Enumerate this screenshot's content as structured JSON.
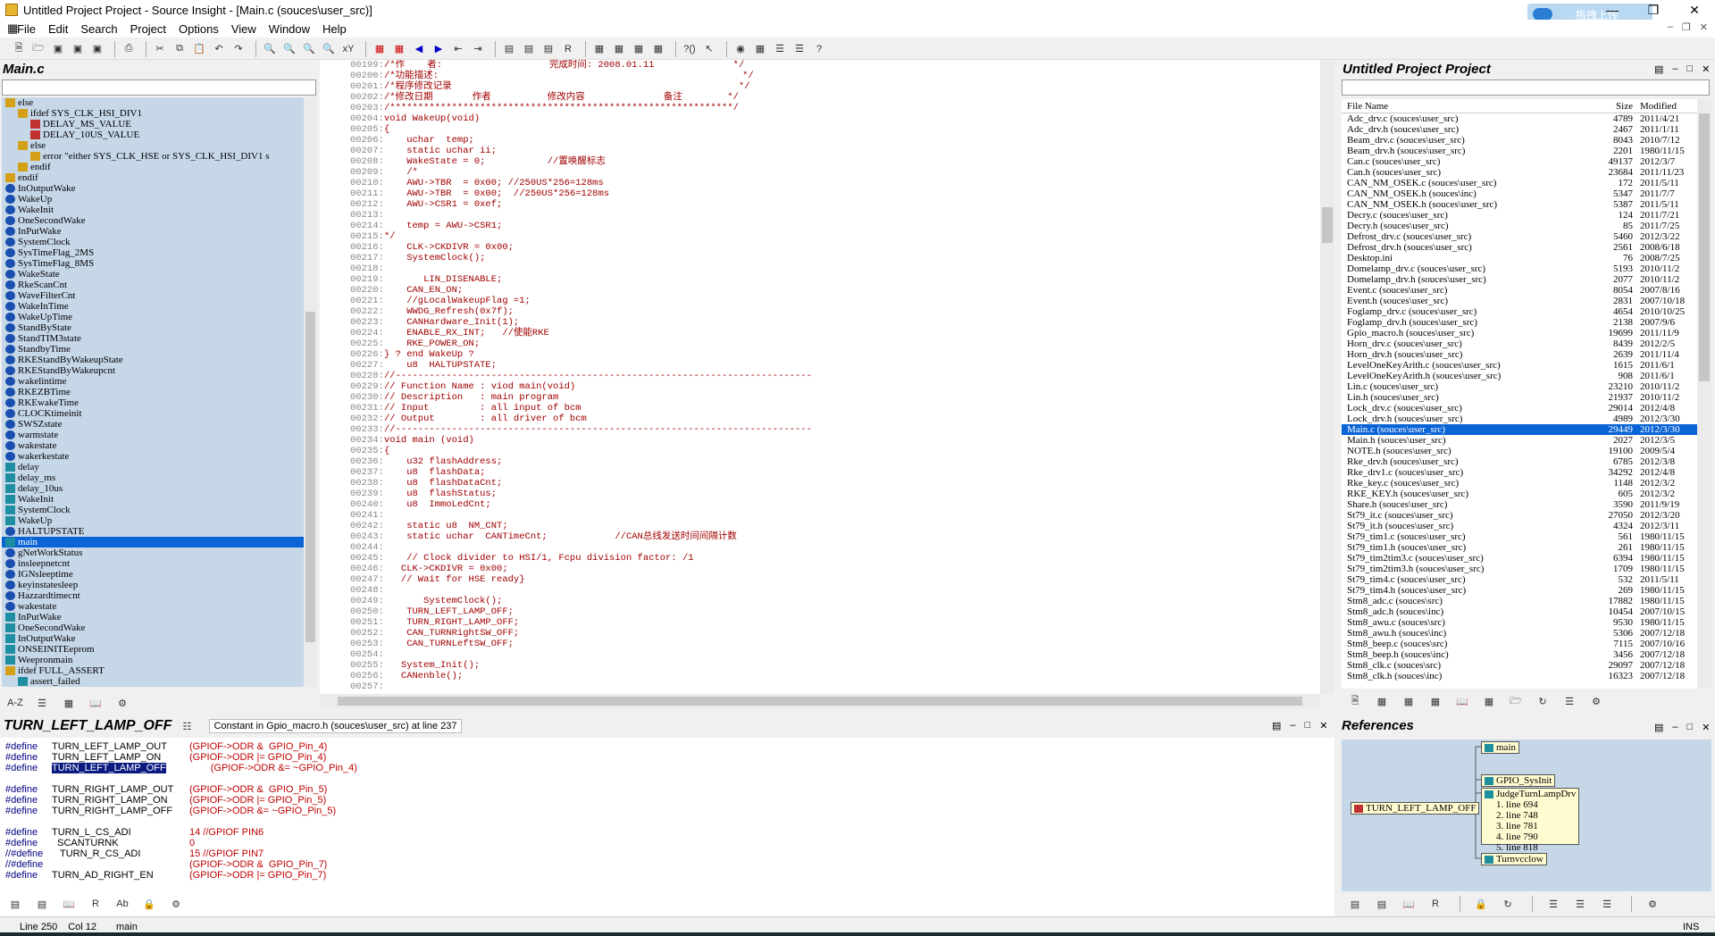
{
  "window": {
    "title": "Untitled Project Project - Source Insight - [Main.c (souces\\user_src)]",
    "upload_label": "拖拽上传"
  },
  "menu": [
    "File",
    "Edit",
    "Search",
    "Project",
    "Options",
    "View",
    "Window",
    "Help"
  ],
  "left": {
    "title": "Main.c",
    "symbols": [
      {
        "t": "else",
        "i": "cond",
        "d": 0
      },
      {
        "t": "ifdef SYS_CLK_HSI_DIV1",
        "i": "cond",
        "d": 1
      },
      {
        "t": "DELAY_MS_VALUE",
        "i": "def",
        "d": 2
      },
      {
        "t": "DELAY_10US_VALUE",
        "i": "def",
        "d": 2
      },
      {
        "t": "else",
        "i": "cond",
        "d": 1
      },
      {
        "t": "error \"either SYS_CLK_HSE or SYS_CLK_HSI_DIV1 s",
        "i": "cond",
        "d": 2
      },
      {
        "t": "endif",
        "i": "cond",
        "d": 1
      },
      {
        "t": "endif",
        "i": "cond",
        "d": 0
      },
      {
        "t": "InOutputWake",
        "i": "var",
        "d": 0
      },
      {
        "t": "WakeUp",
        "i": "var",
        "d": 0
      },
      {
        "t": "WakeInit",
        "i": "var",
        "d": 0
      },
      {
        "t": "OneSecondWake",
        "i": "var",
        "d": 0
      },
      {
        "t": "InPutWake",
        "i": "var",
        "d": 0
      },
      {
        "t": "SystemClock",
        "i": "var",
        "d": 0
      },
      {
        "t": "SysTimeFlag_2MS",
        "i": "var",
        "d": 0
      },
      {
        "t": "SysTimeFlag_8MS",
        "i": "var",
        "d": 0
      },
      {
        "t": "WakeState",
        "i": "var",
        "d": 0
      },
      {
        "t": "RkeScanCnt",
        "i": "var",
        "d": 0
      },
      {
        "t": "WaveFilterCnt",
        "i": "var",
        "d": 0
      },
      {
        "t": "WakeInTime",
        "i": "var",
        "d": 0
      },
      {
        "t": "WakeUpTime",
        "i": "var",
        "d": 0
      },
      {
        "t": "StandByState",
        "i": "var",
        "d": 0
      },
      {
        "t": "StandTIM3state",
        "i": "var",
        "d": 0
      },
      {
        "t": "StandbyTime",
        "i": "var",
        "d": 0
      },
      {
        "t": "RKEStandByWakeupState",
        "i": "var",
        "d": 0
      },
      {
        "t": "RKEStandByWakeupcnt",
        "i": "var",
        "d": 0
      },
      {
        "t": "wakelintime",
        "i": "var",
        "d": 0
      },
      {
        "t": "RKEZBTime",
        "i": "var",
        "d": 0
      },
      {
        "t": "RKEwakeTime",
        "i": "var",
        "d": 0
      },
      {
        "t": "CLOCKtimeinit",
        "i": "var",
        "d": 0
      },
      {
        "t": "SWSZstate",
        "i": "var",
        "d": 0
      },
      {
        "t": "warmstate",
        "i": "var",
        "d": 0
      },
      {
        "t": "wakestate",
        "i": "var",
        "d": 0
      },
      {
        "t": "wakerkestate",
        "i": "var",
        "d": 0
      },
      {
        "t": "delay",
        "i": "func",
        "d": 0
      },
      {
        "t": "delay_ms",
        "i": "func",
        "d": 0
      },
      {
        "t": "delay_10us",
        "i": "func",
        "d": 0
      },
      {
        "t": "WakeInit",
        "i": "func",
        "d": 0
      },
      {
        "t": "SystemClock",
        "i": "func",
        "d": 0
      },
      {
        "t": "WakeUp",
        "i": "func",
        "d": 0
      },
      {
        "t": "HALTUPSTATE",
        "i": "var",
        "d": 0
      },
      {
        "t": "main",
        "i": "func",
        "d": 0,
        "sel": true
      },
      {
        "t": "gNetWorkStatus",
        "i": "var",
        "d": 0
      },
      {
        "t": "insleepnetcnt",
        "i": "var",
        "d": 0
      },
      {
        "t": "IGNsleeptime",
        "i": "var",
        "d": 0
      },
      {
        "t": "keyinstatesleep",
        "i": "var",
        "d": 0
      },
      {
        "t": "Hazzardtimecnt",
        "i": "var",
        "d": 0
      },
      {
        "t": "wakestate",
        "i": "var",
        "d": 0
      },
      {
        "t": "InPutWake",
        "i": "func",
        "d": 0
      },
      {
        "t": "OneSecondWake",
        "i": "func",
        "d": 0
      },
      {
        "t": "InOutputWake",
        "i": "func",
        "d": 0
      },
      {
        "t": "ONSEINITEeprom",
        "i": "func",
        "d": 0
      },
      {
        "t": "Weepronmain",
        "i": "func",
        "d": 0
      },
      {
        "t": "ifdef FULL_ASSERT",
        "i": "cond",
        "d": 0
      },
      {
        "t": "assert_failed",
        "i": "func",
        "d": 1
      }
    ]
  },
  "code": [
    {
      "n": "00199:",
      "s": "/*作    者:                   完成时间: 2008.01.11              */",
      "c": "cm"
    },
    {
      "n": "00200:",
      "s": "/*功能描述:                                                      */",
      "c": "cm"
    },
    {
      "n": "00201:",
      "s": "/*程序修改记录                                                   */",
      "c": "cm"
    },
    {
      "n": "00202:",
      "s": "/*修改日期       作者          修改内容              备注        */",
      "c": "cm"
    },
    {
      "n": "00203:",
      "s": "/*************************************************************/",
      "c": "cm"
    },
    {
      "n": "00204:",
      "s": "void WakeUp(void)",
      "c": "kw"
    },
    {
      "n": "00205:",
      "s": "{",
      "c": "kw"
    },
    {
      "n": "00206:",
      "s": "    uchar  temp;",
      "c": "kw"
    },
    {
      "n": "00207:",
      "s": "    static uchar ii;",
      "c": "kw"
    },
    {
      "n": "00208:",
      "s": "    WakeState = 0;           //置唤醒标志",
      "c": "rd"
    },
    {
      "n": "00209:",
      "s": "    /*",
      "c": "cm"
    },
    {
      "n": "00210:",
      "s": "    AWU->TBR  = 0x00; //250US*256=128ms",
      "c": "cm"
    },
    {
      "n": "00211:",
      "s": "    AWU->TBR  = 0x00;  //250US*256=128ms",
      "c": "cm"
    },
    {
      "n": "00212:",
      "s": "    AWU->CSR1 = 0xef;",
      "c": "cm"
    },
    {
      "n": "00213:",
      "s": "",
      "c": "cm"
    },
    {
      "n": "00214:",
      "s": "    temp = AWU->CSR1;",
      "c": "cm"
    },
    {
      "n": "00215:",
      "s": "*/",
      "c": "cm"
    },
    {
      "n": "00216:",
      "s": "    CLK->CKDIVR = 0x00;",
      "c": "rd"
    },
    {
      "n": "00217:",
      "s": "    SystemClock();",
      "c": "rd"
    },
    {
      "n": "00218:",
      "s": "",
      "c": "kw"
    },
    {
      "n": "00219:",
      "s": "       LIN_DISENABLE;",
      "c": "rd"
    },
    {
      "n": "00220:",
      "s": "    CAN_EN_ON;",
      "c": "rd"
    },
    {
      "n": "00221:",
      "s": "    //gLocalWakeupFlag =1;",
      "c": "rd"
    },
    {
      "n": "00222:",
      "s": "    WWDG_Refresh(0x7f);",
      "c": "rd"
    },
    {
      "n": "00223:",
      "s": "    CANHardware_Init(1);",
      "c": "rd"
    },
    {
      "n": "00224:",
      "s": "    ENABLE_RX_INT;   //使能RKE",
      "c": "rd"
    },
    {
      "n": "00225:",
      "s": "    RKE_POWER_ON;",
      "c": "rd"
    },
    {
      "n": "00226:",
      "s": "} ? end WakeUp ?",
      "c": "kw"
    },
    {
      "n": "00227:",
      "s": "    u8  HALTUPSTATE;",
      "c": "kw"
    },
    {
      "n": "00228:",
      "s": "//--------------------------------------------------------------------------",
      "c": "cm"
    },
    {
      "n": "00229:",
      "s": "// Function Name : viod main(void)",
      "c": "cm"
    },
    {
      "n": "00230:",
      "s": "// Description   : main program",
      "c": "cm"
    },
    {
      "n": "00231:",
      "s": "// Input         : all input of bcm",
      "c": "cm"
    },
    {
      "n": "00232:",
      "s": "// Output        : all driver of bcm",
      "c": "cm"
    },
    {
      "n": "00233:",
      "s": "//--------------------------------------------------------------------------",
      "c": "cm"
    },
    {
      "n": "00234:",
      "s": "void main (void)",
      "c": "kw"
    },
    {
      "n": "00235:",
      "s": "{",
      "c": "kw"
    },
    {
      "n": "00236:",
      "s": "    u32 flashAddress;",
      "c": "kw"
    },
    {
      "n": "00237:",
      "s": "    u8  flashData;",
      "c": "kw"
    },
    {
      "n": "00238:",
      "s": "    u8  flashDataCnt;",
      "c": "kw"
    },
    {
      "n": "00239:",
      "s": "    u8  flashStatus;",
      "c": "kw"
    },
    {
      "n": "00240:",
      "s": "    u8  ImmoLedCnt;",
      "c": "kw"
    },
    {
      "n": "00241:",
      "s": "",
      "c": "kw"
    },
    {
      "n": "00242:",
      "s": "    static u8  NM_CNT;",
      "c": "kw"
    },
    {
      "n": "00243:",
      "s": "    static uchar  CANTimeCnt;            //CAN总线发送时间间隔计数",
      "c": "kw"
    },
    {
      "n": "00244:",
      "s": "",
      "c": "kw"
    },
    {
      "n": "00245:",
      "s": "    // Clock divider to HSI/1, Fcpu division factor: /1",
      "c": "cm"
    },
    {
      "n": "00246:",
      "s": "   CLK->CKDIVR = 0x00;",
      "c": "rd"
    },
    {
      "n": "00247:",
      "s": "   // Wait for HSE ready}",
      "c": "cm"
    },
    {
      "n": "00248:",
      "s": "",
      "c": "kw"
    },
    {
      "n": "00249:",
      "s": "       SystemClock();",
      "c": "rd"
    },
    {
      "n": "00250:",
      "s": "    TURN_LEFT_LAMP_OFF;",
      "c": "rd"
    },
    {
      "n": "00251:",
      "s": "    TURN_RIGHT_LAMP_OFF;",
      "c": "rd"
    },
    {
      "n": "00252:",
      "s": "    CAN_TURNRightSW_OFF;",
      "c": "rd"
    },
    {
      "n": "00253:",
      "s": "    CAN_TURNLeftSW_OFF;",
      "c": "rd"
    },
    {
      "n": "00254:",
      "s": "",
      "c": "kw"
    },
    {
      "n": "00255:",
      "s": "   System_Init();",
      "c": "rd"
    },
    {
      "n": "00256:",
      "s": "   CANenble();",
      "c": "rd"
    },
    {
      "n": "00257:",
      "s": "",
      "c": "kw"
    }
  ],
  "project": {
    "title": "Untitled Project Project",
    "headers": [
      "File Name",
      "Size",
      "Modified"
    ],
    "files": [
      [
        "Adc_drv.c (souces\\user_src)",
        "4789",
        "2011/4/21"
      ],
      [
        "Adc_drv.h (souces\\user_src)",
        "2467",
        "2011/1/11"
      ],
      [
        "Beam_drv.c (souces\\user_src)",
        "8043",
        "2010/7/12"
      ],
      [
        "Beam_drv.h (souces\\user_src)",
        "2201",
        "1980/11/15"
      ],
      [
        "Can.c (souces\\user_src)",
        "49137",
        "2012/3/7"
      ],
      [
        "Can.h (souces\\user_src)",
        "23684",
        "2011/11/23"
      ],
      [
        "CAN_NM_OSEK.c (souces\\user_src)",
        "172",
        "2011/5/11"
      ],
      [
        "CAN_NM_OSEK.h (souces\\inc)",
        "5347",
        "2011/7/7"
      ],
      [
        "CAN_NM_OSEK.h (souces\\user_src)",
        "5387",
        "2011/5/11"
      ],
      [
        "Decry.c (souces\\user_src)",
        "124",
        "2011/7/21"
      ],
      [
        "Decry.h (souces\\user_src)",
        "85",
        "2011/7/25"
      ],
      [
        "Defrost_drv.c (souces\\user_src)",
        "5460",
        "2012/3/22"
      ],
      [
        "Defrost_drv.h (souces\\user_src)",
        "2561",
        "2008/6/18"
      ],
      [
        "Desktop.ini",
        "76",
        "2008/7/25"
      ],
      [
        "Domelamp_drv.c (souces\\user_src)",
        "5193",
        "2010/11/2"
      ],
      [
        "Domelamp_drv.h (souces\\user_src)",
        "2077",
        "2010/11/2"
      ],
      [
        "Event.c (souces\\user_src)",
        "8054",
        "2007/8/16"
      ],
      [
        "Event.h (souces\\user_src)",
        "2831",
        "2007/10/18"
      ],
      [
        "Foglamp_drv.c (souces\\user_src)",
        "4654",
        "2010/10/25"
      ],
      [
        "Foglamp_drv.h (souces\\user_src)",
        "2138",
        "2007/9/6"
      ],
      [
        "Gpio_macro.h (souces\\user_src)",
        "19699",
        "2011/11/9"
      ],
      [
        "Horn_drv.c (souces\\user_src)",
        "8439",
        "2012/2/5"
      ],
      [
        "Horn_drv.h (souces\\user_src)",
        "2639",
        "2011/11/4"
      ],
      [
        "LevelOneKeyArith.c (souces\\user_src)",
        "1615",
        "2011/6/1"
      ],
      [
        "LevelOneKeyArith.h (souces\\user_src)",
        "908",
        "2011/6/1"
      ],
      [
        "Lin.c (souces\\user_src)",
        "23210",
        "2010/11/2"
      ],
      [
        "Lin.h (souces\\user_src)",
        "21937",
        "2010/11/2"
      ],
      [
        "Lock_drv.c (souces\\user_src)",
        "29014",
        "2012/4/8"
      ],
      [
        "Lock_drv.h (souces\\user_src)",
        "4989",
        "2012/3/30"
      ],
      [
        "Main.c (souces\\user_src)",
        "29449",
        "2012/3/30"
      ],
      [
        "Main.h (souces\\user_src)",
        "2027",
        "2012/3/5"
      ],
      [
        "NOTE.h (souces\\user_src)",
        "19100",
        "2009/5/4"
      ],
      [
        "Rke_drv.h (souces\\user_src)",
        "6785",
        "2012/3/8"
      ],
      [
        "Rke_drv1.c (souces\\user_src)",
        "34292",
        "2012/4/8"
      ],
      [
        "Rke_key.c (souces\\user_src)",
        "1148",
        "2012/3/2"
      ],
      [
        "RKE_KEY.h (souces\\user_src)",
        "605",
        "2012/3/2"
      ],
      [
        "Share.h (souces\\user_src)",
        "3590",
        "2011/9/19"
      ],
      [
        "St79_it.c (souces\\user_src)",
        "27050",
        "2012/3/20"
      ],
      [
        "St79_it.h (souces\\user_src)",
        "4324",
        "2012/3/11"
      ],
      [
        "St79_tim1.c (souces\\user_src)",
        "561",
        "1980/11/15"
      ],
      [
        "St79_tim1.h (souces\\user_src)",
        "261",
        "1980/11/15"
      ],
      [
        "St79_tim2tim3.c (souces\\user_src)",
        "6394",
        "1980/11/15"
      ],
      [
        "St79_tim2tim3.h (souces\\user_src)",
        "1709",
        "1980/11/15"
      ],
      [
        "St79_tim4.c (souces\\user_src)",
        "532",
        "2011/5/11"
      ],
      [
        "St79_tim4.h (souces\\user_src)",
        "269",
        "1980/11/15"
      ],
      [
        "Stm8_adc.c (souces\\src)",
        "17882",
        "1980/11/15"
      ],
      [
        "Stm8_adc.h (souces\\inc)",
        "10454",
        "2007/10/15"
      ],
      [
        "Stm8_awu.c (souces\\src)",
        "9530",
        "1980/11/15"
      ],
      [
        "Stm8_awu.h (souces\\inc)",
        "5306",
        "2007/12/18"
      ],
      [
        "Stm8_beep.c (souces\\src)",
        "7115",
        "2007/10/16"
      ],
      [
        "Stm8_beep.h (souces\\inc)",
        "3456",
        "2007/12/18"
      ],
      [
        "Stm8_clk.c (souces\\src)",
        "29097",
        "2007/12/18"
      ],
      [
        "Stm8_clk.h (souces\\inc)",
        "16323",
        "2007/12/18"
      ]
    ],
    "selected_index": 29
  },
  "context": {
    "symbol": "TURN_LEFT_LAMP_OFF",
    "info": "Constant in Gpio_macro.h (souces\\user_src) at line 237",
    "lines": [
      [
        "#define",
        "TURN_LEFT_LAMP_OUT",
        "(GPIOF->ODR &  GPIO_Pin_4)"
      ],
      [
        "#define",
        "TURN_LEFT_LAMP_ON",
        "(GPIOF->ODR |= GPIO_Pin_4)"
      ],
      [
        "#define",
        "TURN_LEFT_LAMP_OFF",
        "(GPIOF->ODR &= ~GPIO_Pin_4)"
      ],
      [
        "",
        "",
        ""
      ],
      [
        "#define",
        "TURN_RIGHT_LAMP_OUT",
        "(GPIOF->ODR &  GPIO_Pin_5)"
      ],
      [
        "#define",
        "TURN_RIGHT_LAMP_ON",
        "(GPIOF->ODR |= GPIO_Pin_5)"
      ],
      [
        "#define",
        "TURN_RIGHT_LAMP_OFF",
        "(GPIOF->ODR &= ~GPIO_Pin_5)"
      ],
      [
        "",
        "",
        ""
      ],
      [
        "#define",
        "TURN_L_CS_ADI",
        "14 //GPIOF PIN6"
      ],
      [
        "#define",
        "  SCANTURNK",
        "0"
      ],
      [
        "//#define",
        "   TURN_R_CS_ADI",
        "15 //GPIOF PIN7"
      ],
      [
        "//#define",
        "",
        "(GPIOF->ODR &  GPIO_Pin_7)"
      ],
      [
        "#define",
        "TURN_AD_RIGHT_EN",
        "(GPIOF->ODR |= GPIO_Pin_7)"
      ]
    ]
  },
  "references": {
    "title": "References",
    "root": "TURN_LEFT_LAMP_OFF",
    "nodes": [
      "main",
      "GPIO_SysInit",
      "JudgeTurnLampDrv",
      "Turnvcclow"
    ],
    "lines": [
      "1. line 694",
      "2. line 748",
      "3. line 781",
      "4. line 790",
      "5. line 818"
    ]
  },
  "status": {
    "line": "Line 250",
    "col": "Col 12",
    "func": "main",
    "mode": "INS"
  }
}
